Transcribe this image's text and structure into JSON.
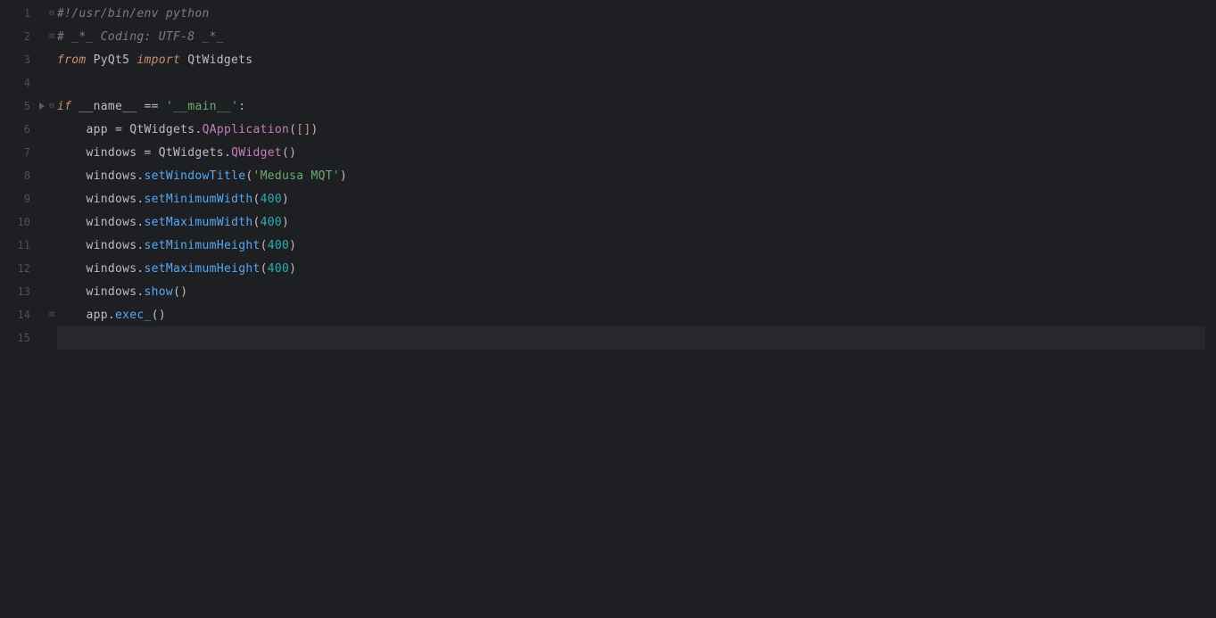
{
  "lineNumbers": [
    "1",
    "2",
    "3",
    "4",
    "5",
    "6",
    "7",
    "8",
    "9",
    "10",
    "11",
    "12",
    "13",
    "14",
    "15"
  ],
  "code": {
    "l1": {
      "comment": "#!/usr/bin/env python"
    },
    "l2": {
      "comment": "# _*_ Coding: UTF-8 _*_"
    },
    "l3": {
      "kw1": "from",
      "mod": " PyQt5 ",
      "kw2": "import",
      "imp": " QtWidgets"
    },
    "l5": {
      "kw": "if",
      "name": " __name__ ",
      "op": "== ",
      "str": "'__main__'",
      "colon": ":"
    },
    "l6": {
      "var": "app ",
      "op": "= ",
      "cls": "QtWidgets",
      "dot": ".",
      "fn": "QApplication",
      "p1": "(",
      "br1": "[",
      "br2": "]",
      "p2": ")"
    },
    "l7": {
      "var": "windows ",
      "op": "= ",
      "cls": "QtWidgets",
      "dot": ".",
      "fn": "QWidget",
      "p1": "(",
      "p2": ")"
    },
    "l8": {
      "var": "windows",
      "dot": ".",
      "fn": "setWindowTitle",
      "p1": "(",
      "str": "'Medusa MQT'",
      "p2": ")"
    },
    "l9": {
      "var": "windows",
      "dot": ".",
      "fn": "setMinimumWidth",
      "p1": "(",
      "num": "400",
      "p2": ")"
    },
    "l10": {
      "var": "windows",
      "dot": ".",
      "fn": "setMaximumWidth",
      "p1": "(",
      "num": "400",
      "p2": ")"
    },
    "l11": {
      "var": "windows",
      "dot": ".",
      "fn": "setMinimumHeight",
      "p1": "(",
      "num": "400",
      "p2": ")"
    },
    "l12": {
      "var": "windows",
      "dot": ".",
      "fn": "setMaximumHeight",
      "p1": "(",
      "num": "400",
      "p2": ")"
    },
    "l13": {
      "var": "windows",
      "dot": ".",
      "fn": "show",
      "p1": "(",
      "p2": ")"
    },
    "l14": {
      "var": "app",
      "dot": ".",
      "fn": "exec_",
      "p1": "(",
      "p2": ")"
    }
  },
  "indent": {
    "none": "",
    "one": "    ",
    "two": "        "
  }
}
